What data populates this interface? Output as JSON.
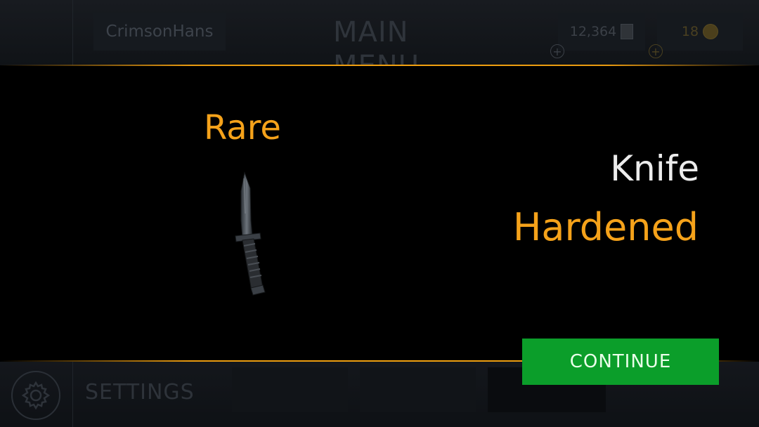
{
  "header": {
    "username": "CrimsonHans",
    "title": "MAIN MENU",
    "credits": "12,364",
    "gold": "18"
  },
  "footer": {
    "settings_label": "SETTINGS"
  },
  "reward": {
    "rarity": "Rare",
    "weapon": "Knife",
    "skin": "Hardened",
    "continue_label": "CONTINUE"
  },
  "colors": {
    "accent_gold": "#f5a21a",
    "continue_green": "#0b9e2a"
  },
  "icons": [
    "gear-icon",
    "credits-icon",
    "gold-coin-icon",
    "plus-icon",
    "knife-item-image"
  ]
}
